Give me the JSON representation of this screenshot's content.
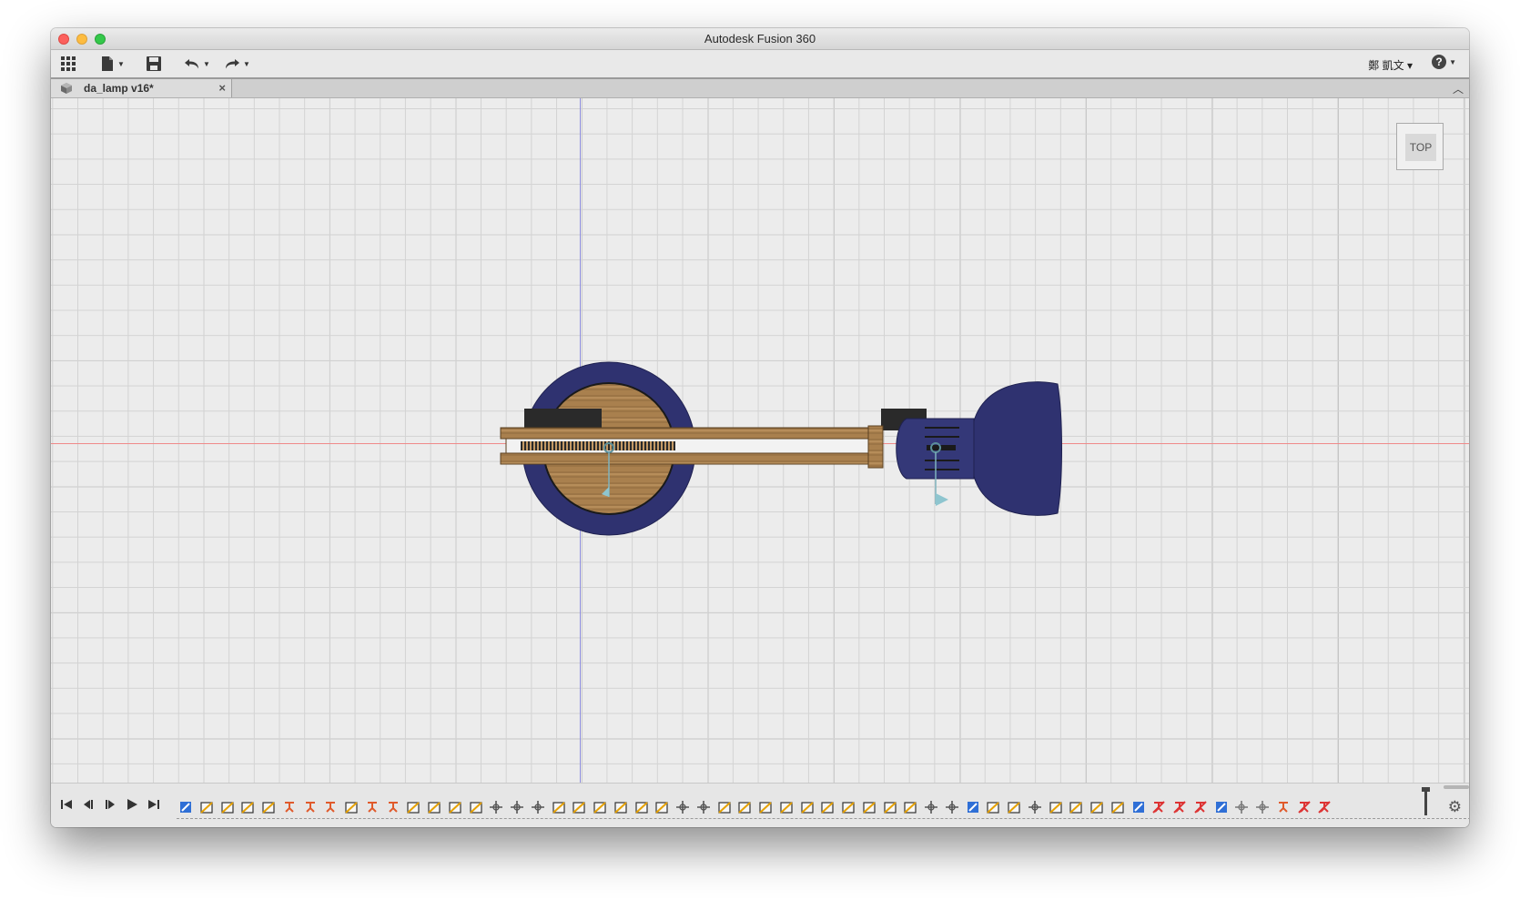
{
  "window": {
    "title": "Autodesk Fusion 360"
  },
  "toolbar": {
    "apps_icon": "grid-icon",
    "file_icon": "file-icon",
    "save_icon": "save-icon",
    "undo_icon": "undo-icon",
    "redo_icon": "redo-icon",
    "user_name": "鄭 凱文 ▾",
    "help_label": "?"
  },
  "tabs": [
    {
      "label": "da_lamp v16*",
      "close": "×"
    }
  ],
  "viewcube": {
    "face_label": "TOP"
  },
  "colors": {
    "lamp_shade": "#2f3270",
    "wood": "#a9804e",
    "axis_x": "#ef8a8a",
    "axis_y": "#8f8fe0",
    "grid": "#d3d3d3"
  },
  "timeline": {
    "controls": [
      "go-to-start",
      "step-back",
      "step-forward",
      "play",
      "go-to-end"
    ],
    "features": [
      "sketch",
      "extrude",
      "offset-plane",
      "extrude",
      "plane",
      "joint",
      "joint",
      "joint",
      "sweep",
      "joint",
      "joint",
      "sweep",
      "box",
      "extrude",
      "plane",
      "move",
      "move",
      "align",
      "sweep",
      "extrude",
      "extrude",
      "revolve",
      "loft",
      "loft",
      "mirror",
      "mirror",
      "sweep",
      "sweep",
      "extrude",
      "plane",
      "revolve",
      "extrude",
      "cylinder",
      "extrude",
      "plane",
      "plane",
      "move",
      "move",
      "sketch",
      "plane",
      "plane",
      "align",
      "extrude",
      "plane",
      "shell",
      "plane",
      "sketch",
      "suppressed",
      "suppressed",
      "suppressed",
      "sketch",
      "pattern",
      "pattern",
      "joint",
      "suppressed",
      "suppressed"
    ],
    "settings_icon": "gear-icon"
  }
}
